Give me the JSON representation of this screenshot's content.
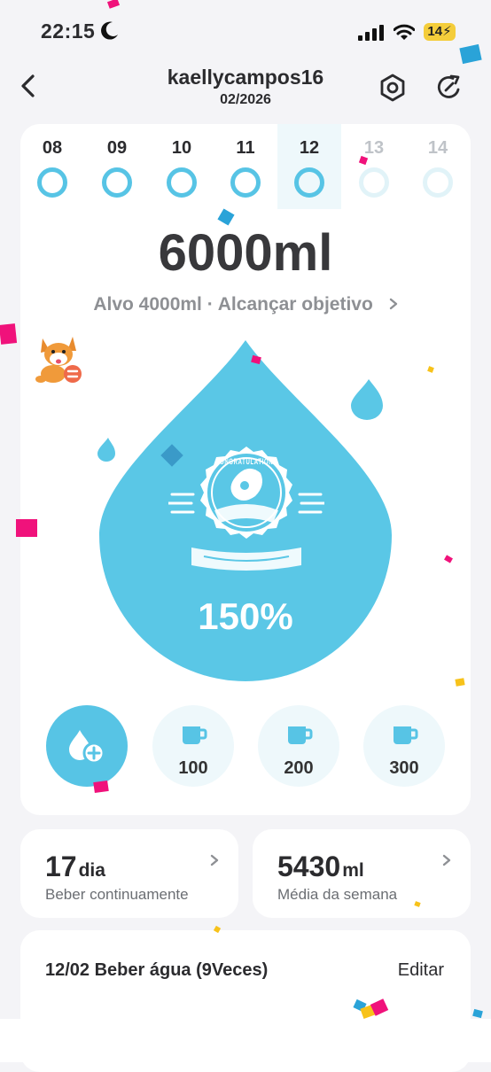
{
  "status_bar": {
    "time": "22:15",
    "battery": "14"
  },
  "header": {
    "username": "kaellycampos16",
    "month": "02/2026"
  },
  "days": [
    {
      "label": "08",
      "state": "past"
    },
    {
      "label": "09",
      "state": "past"
    },
    {
      "label": "10",
      "state": "past"
    },
    {
      "label": "11",
      "state": "past"
    },
    {
      "label": "12",
      "state": "selected"
    },
    {
      "label": "13",
      "state": "future"
    },
    {
      "label": "14",
      "state": "future"
    }
  ],
  "intake": {
    "amount": "6000ml",
    "target_text": "Alvo 4000ml · Alcançar objetivo",
    "badge_text": "CONGRATULATIONS",
    "percent": "150%"
  },
  "quick_add": [
    {
      "label": "100"
    },
    {
      "label": "200"
    },
    {
      "label": "300"
    }
  ],
  "stats": {
    "streak": {
      "value": "17",
      "unit": "dia",
      "label": "Beber continuamente"
    },
    "weekly": {
      "value": "5430",
      "unit": "ml",
      "label": "Média da semana"
    }
  },
  "log": {
    "title": "12/02 Beber água (9Veces)",
    "edit_label": "Editar"
  },
  "colors": {
    "accent": "#57c4e5",
    "pale_accent": "#eef8fb",
    "confetti_pink": "#f0127b",
    "confetti_blue": "#2aa3d8",
    "confetti_yellow": "#f7c21a"
  },
  "icons": [
    "moon-icon",
    "signal-icon",
    "wifi-icon",
    "back-arrow-icon",
    "hexagon-settings-icon",
    "refresh-icon",
    "dog-mascot-icon",
    "water-drop-icon",
    "add-drink-icon",
    "cup-icon",
    "chevron-right-icon"
  ]
}
